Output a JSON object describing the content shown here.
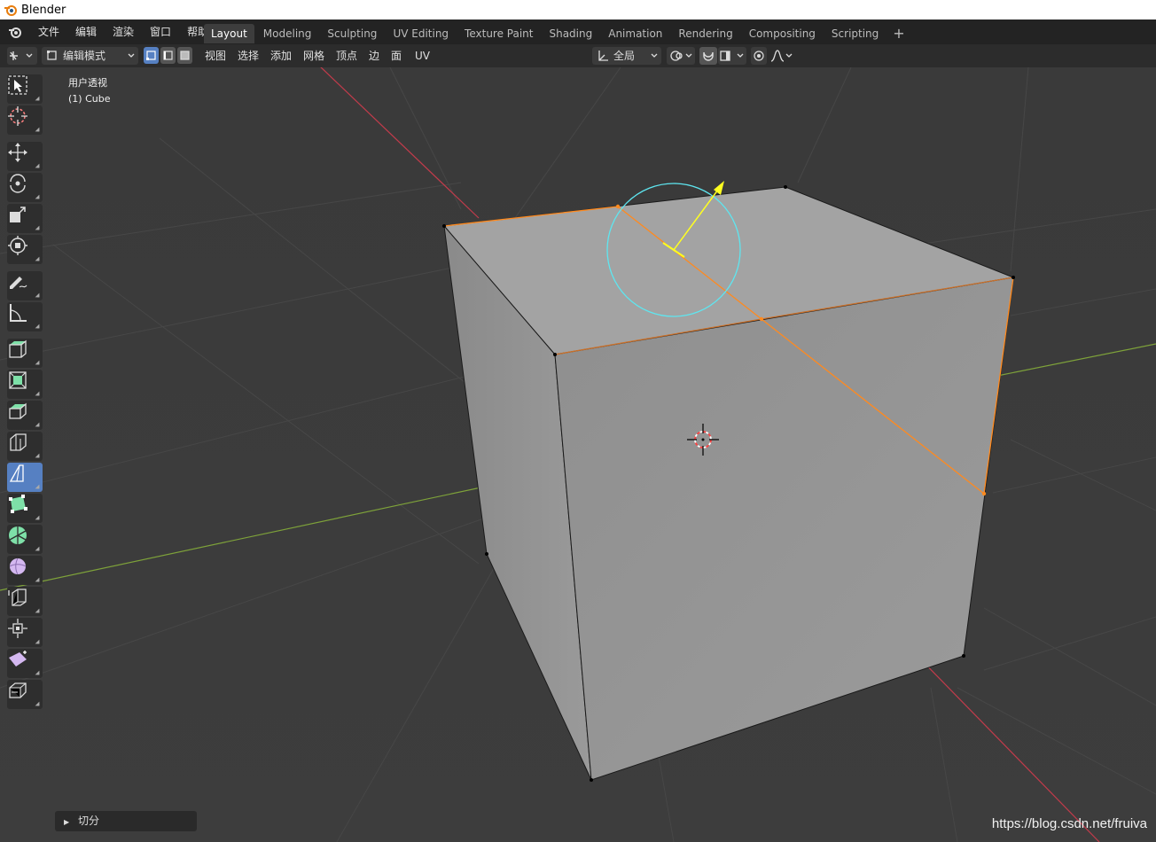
{
  "window": {
    "title": "Blender"
  },
  "menubar": {
    "items": [
      "文件",
      "编辑",
      "渲染",
      "窗口",
      "帮助"
    ]
  },
  "workspace_tabs": {
    "items": [
      "Layout",
      "Modeling",
      "Sculpting",
      "UV Editing",
      "Texture Paint",
      "Shading",
      "Animation",
      "Rendering",
      "Compositing",
      "Scripting"
    ],
    "active": "Layout",
    "add_label": "+"
  },
  "header": {
    "mode": "编辑模式",
    "menus": [
      "视图",
      "选择",
      "添加",
      "网格",
      "顶点",
      "边",
      "面",
      "UV"
    ],
    "transform_orientation": "全局"
  },
  "viewport": {
    "view_name": "用户透视",
    "object_label": "(1) Cube"
  },
  "toolbar": {
    "tools": [
      "select-box",
      "cursor",
      "move",
      "rotate",
      "scale",
      "transform",
      "annotate",
      "measure",
      "add-cube",
      "extrude-region",
      "inset-faces",
      "bevel",
      "loop-cut",
      "knife",
      "poly-build",
      "spin",
      "smooth",
      "edge-slide",
      "shrink-fatten",
      "shear",
      "rip-region"
    ],
    "active": "knife"
  },
  "operator_panel": {
    "label": "切分"
  },
  "watermark": "https://blog.csdn.net/fruiva",
  "colors": {
    "accent": "#5680c2",
    "selection": "#ff8a1f",
    "gizmo_circle": "#5ee6f0",
    "gizmo_arrow": "#ffff20",
    "x_axis": "#c23b4b",
    "y_axis": "#7ea23a"
  }
}
